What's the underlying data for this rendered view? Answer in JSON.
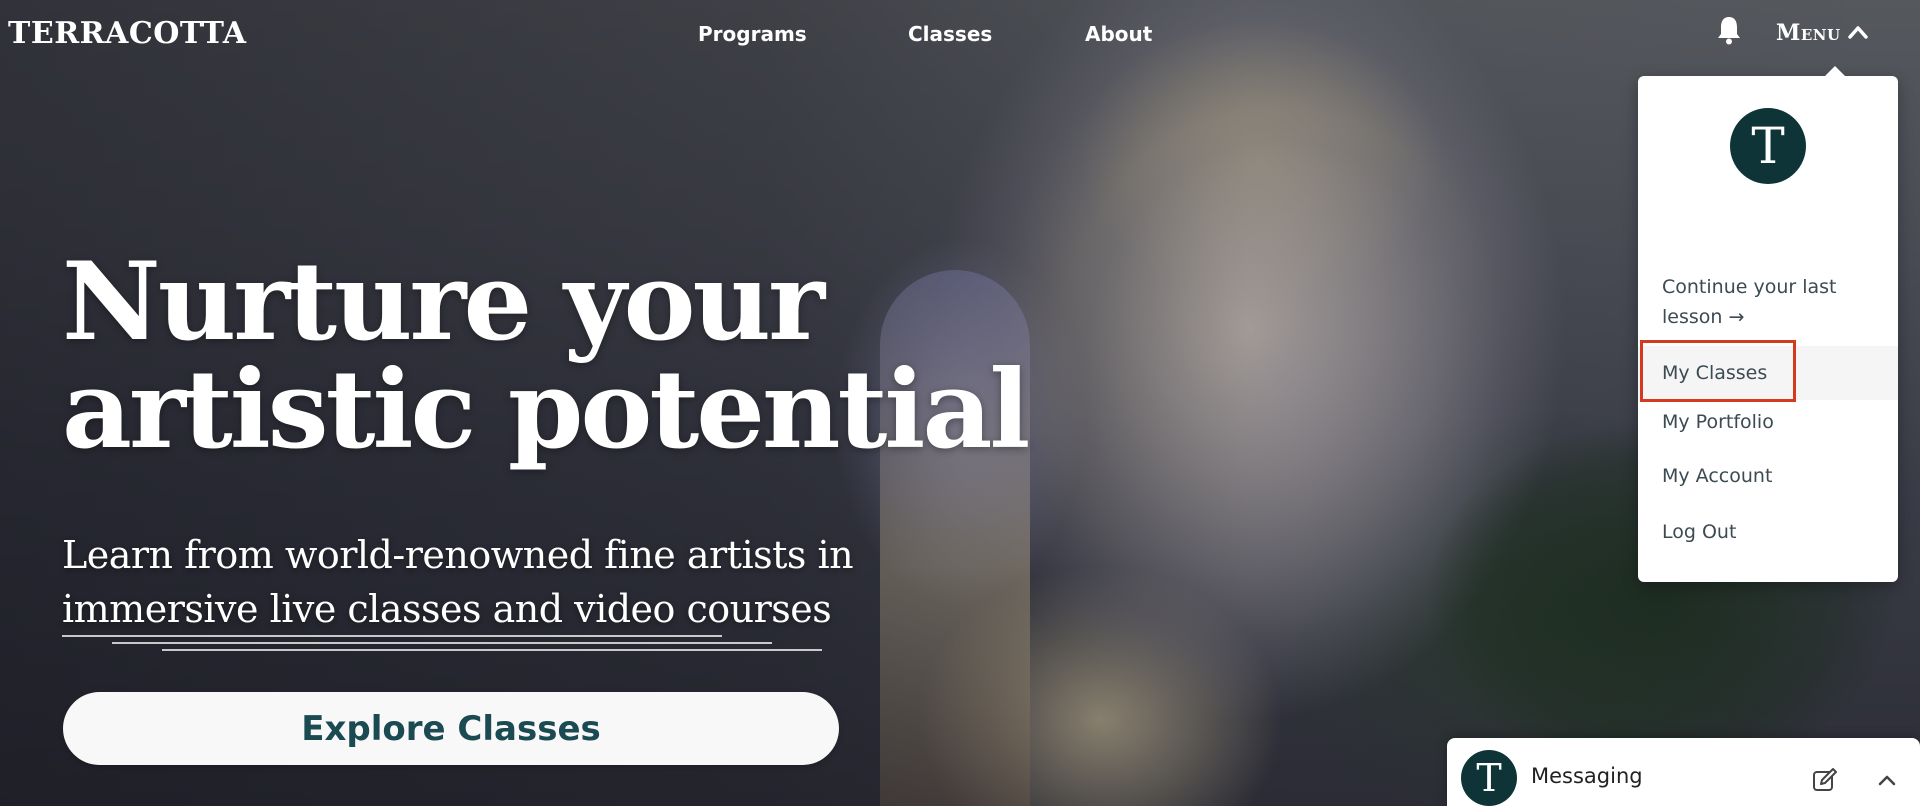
{
  "brand": {
    "logo_text": "TERRACOTTA"
  },
  "nav": {
    "items": [
      {
        "label": "Programs"
      },
      {
        "label": "Classes"
      },
      {
        "label": "About"
      }
    ],
    "menu_label": "Menu",
    "bell_icon": "bell-icon",
    "menu_chevron_icon": "chevron-up-icon"
  },
  "hero": {
    "title_line1": "Nurture your",
    "title_line2": "artistic potential",
    "subtitle_line1": "Learn from world-renowned fine artists in",
    "subtitle_line2": "immersive live classes and video courses",
    "cta_label": "Explore Classes"
  },
  "user_menu": {
    "avatar_letter": "T",
    "items": [
      {
        "label": "Continue your last lesson →"
      },
      {
        "label": "My Classes"
      },
      {
        "label": "My Portfolio"
      },
      {
        "label": "My Account"
      },
      {
        "label": "Log Out"
      }
    ],
    "highlighted_item": "My Classes",
    "highlight_color": "#d43a1f"
  },
  "messaging": {
    "avatar_letter": "T",
    "title": "Messaging",
    "compose_icon": "compose-icon",
    "collapse_icon": "chevron-up-icon"
  },
  "colors": {
    "brand_dark_teal": "#0e3438",
    "cta_text": "#1b4a52",
    "menu_text": "#3c4a52"
  }
}
